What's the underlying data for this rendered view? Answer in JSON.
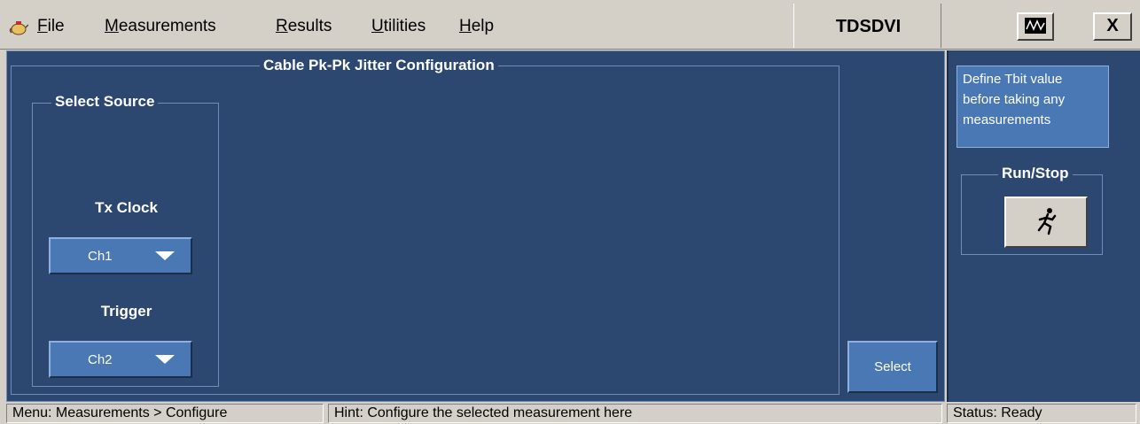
{
  "menubar": {
    "app_icon": "app-teapot-icon",
    "items": [
      {
        "label": "File",
        "u": "F",
        "rest": "ile"
      },
      {
        "label": "Measurements",
        "u": "M",
        "rest": "easurements"
      },
      {
        "label": "Results",
        "u": "R",
        "rest": "esults"
      },
      {
        "label": "Utilities",
        "u": "U",
        "rest": "tilities"
      },
      {
        "label": "Help",
        "u": "H",
        "rest": "elp"
      }
    ],
    "app_title": "TDSDVI",
    "scope_icon": "scope-waveform-icon",
    "close_label": "X"
  },
  "config": {
    "title": "Cable Pk-Pk Jitter Configuration",
    "source_group_title": "Select Source",
    "tx_clock_label": "Tx Clock",
    "tx_clock_value": "Ch1",
    "trigger_label": "Trigger",
    "trigger_value": "Ch2",
    "select_button": "Select"
  },
  "right_panel": {
    "hint_lines": [
      "Define Tbit value",
      "before taking any",
      "measurements"
    ],
    "runstop_title": "Run/Stop",
    "run_icon": "running-man-icon"
  },
  "statusbar": {
    "menu": "Menu: Measurements > Configure",
    "hint": "Hint: Configure the selected measurement here",
    "status": "Status: Ready"
  },
  "colors": {
    "panel": "#2c4770",
    "button_blue": "#4a78b5",
    "chrome": "#d4d0c8"
  }
}
